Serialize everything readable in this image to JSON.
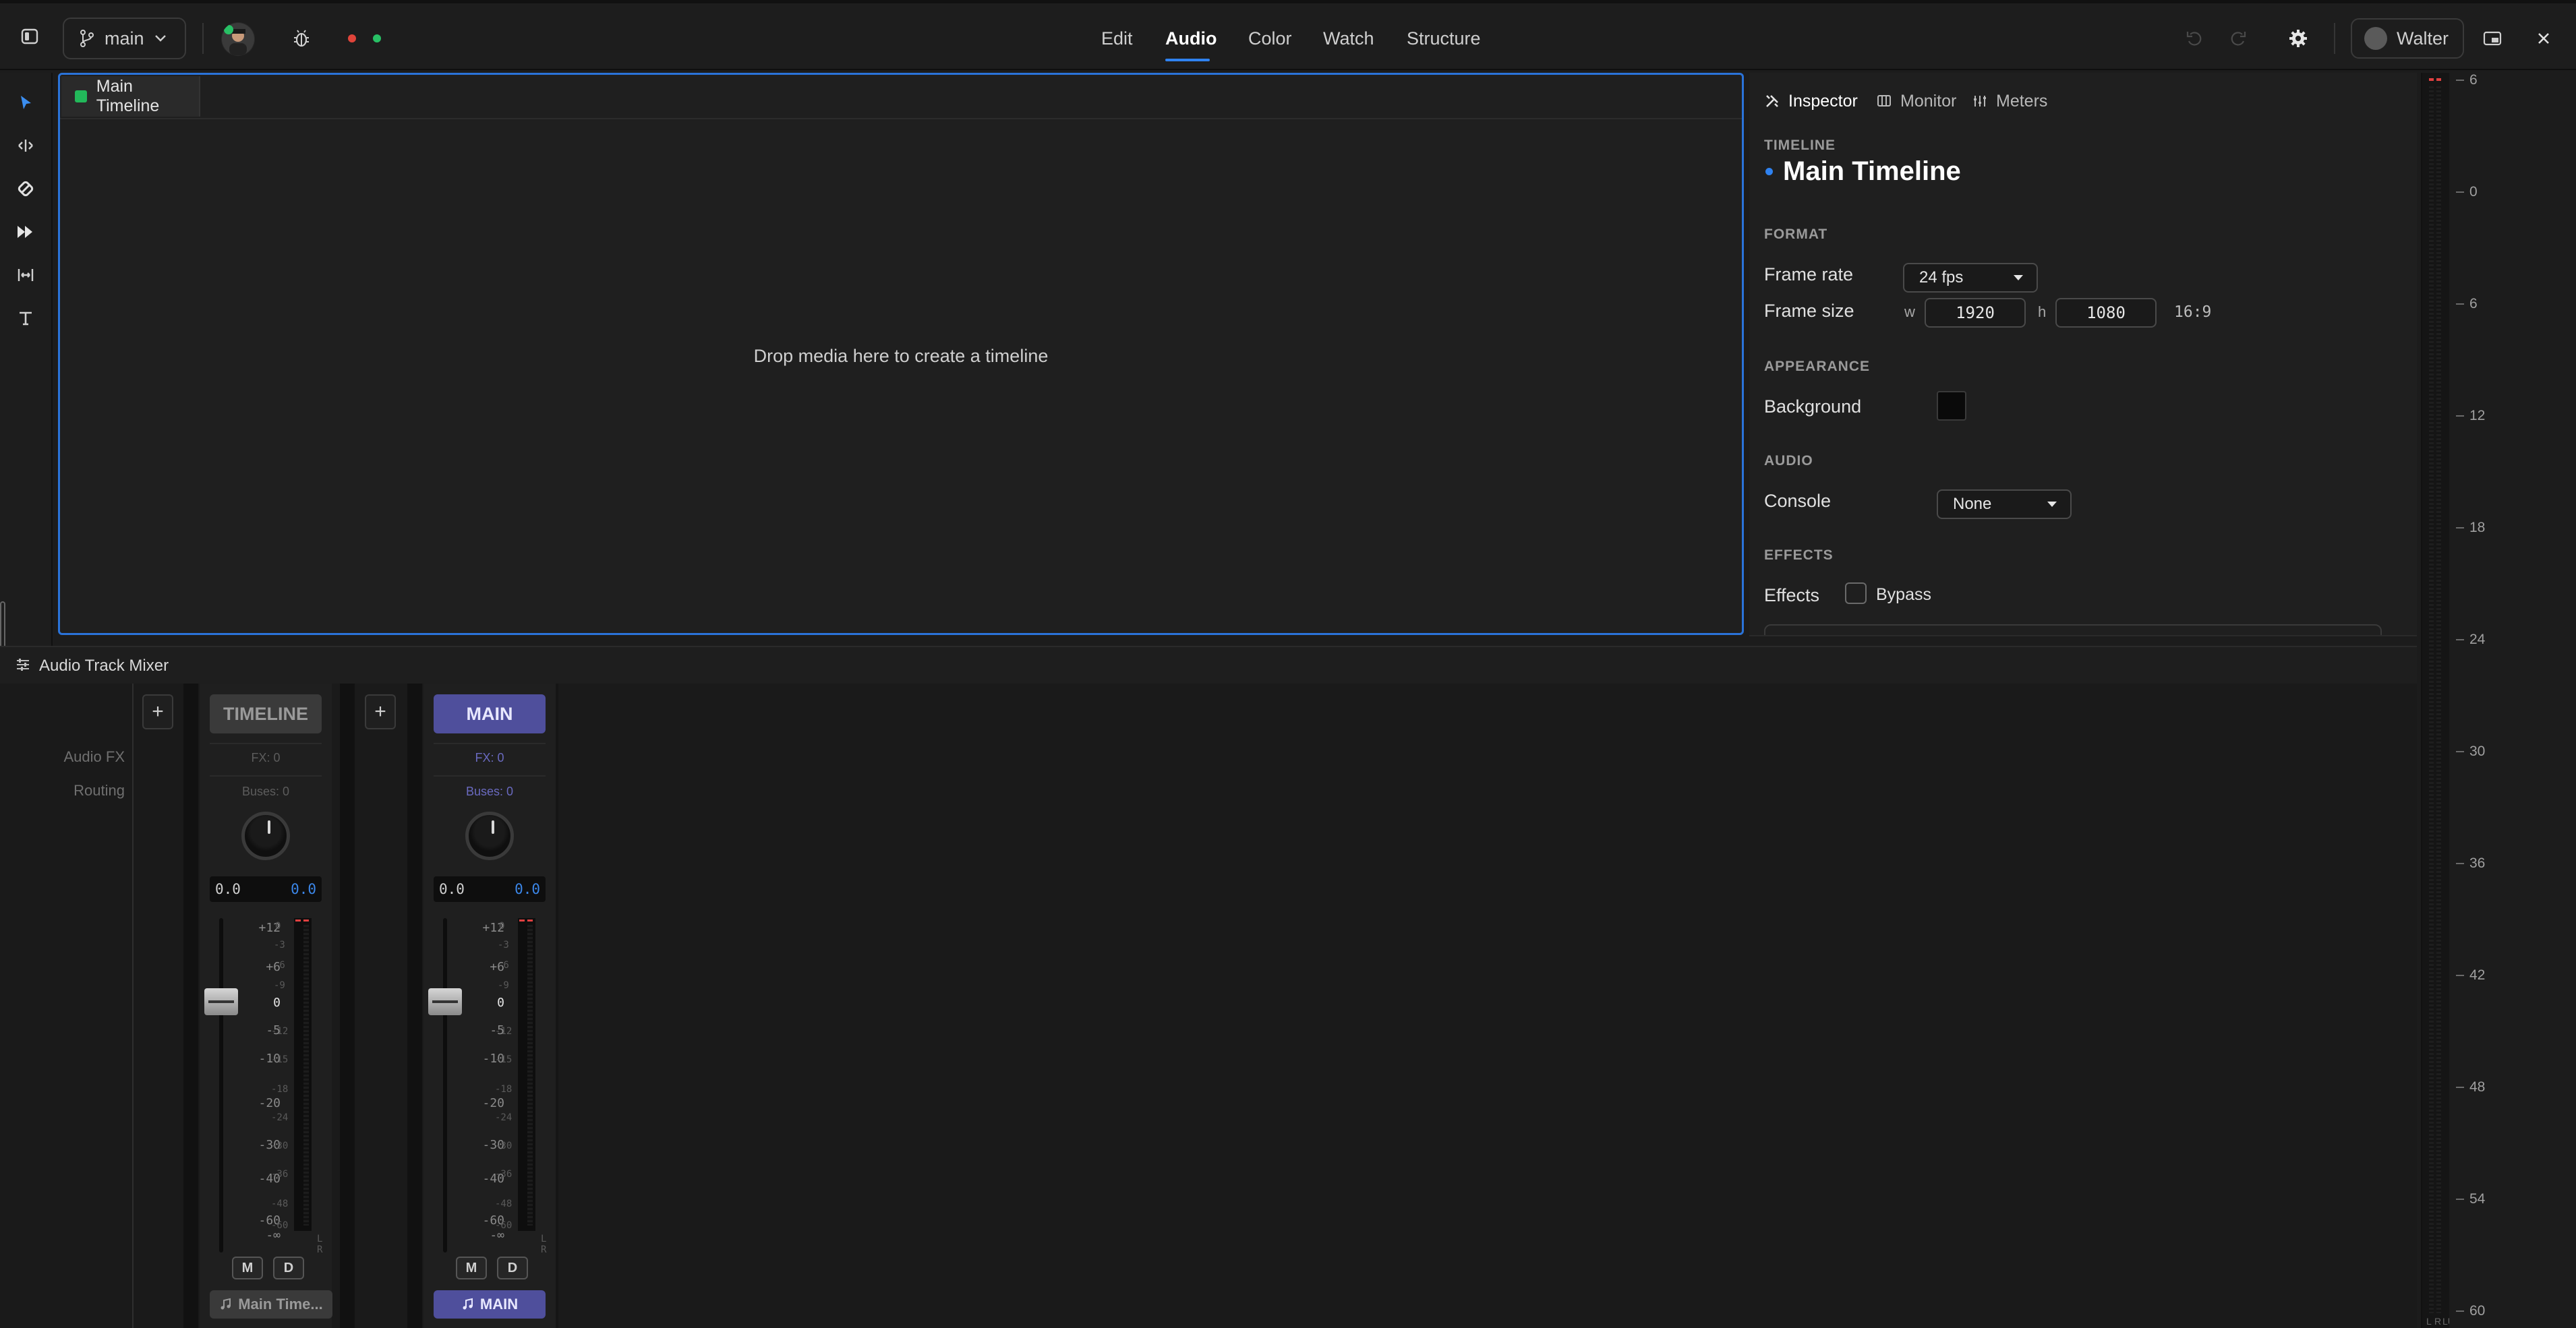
{
  "topbar": {
    "branch": "main",
    "nav": [
      "Edit",
      "Audio",
      "Color",
      "Watch",
      "Structure"
    ],
    "active_nav": "Audio",
    "user": "Walter",
    "status_dot_colors": [
      "#e0443a",
      "#28c065"
    ],
    "icons": [
      "sidebar-toggle-icon",
      "git-branch-icon",
      "chevron-down-icon",
      "bug-icon",
      "undo-icon",
      "redo-icon",
      "gear-icon",
      "picture-in-picture-icon",
      "close-icon"
    ]
  },
  "tools": [
    "pointer-icon",
    "trim-icon",
    "razor-icon",
    "forward-icon",
    "slip-icon",
    "text-icon"
  ],
  "timeline": {
    "tab_label": "Main Timeline",
    "tab_color": "#22b85a",
    "drop_text": "Drop media here to create a timeline"
  },
  "inspector": {
    "tabs": [
      "Inspector",
      "Monitor",
      "Meters"
    ],
    "active_tab": "Inspector",
    "timeline_section": "TIMELINE",
    "timeline_name": "Main Timeline",
    "format_section": "FORMAT",
    "frame_rate_label": "Frame rate",
    "frame_rate_value": "24 fps",
    "frame_size_label": "Frame size",
    "w_label": "w",
    "width_value": "1920",
    "h_label": "h",
    "height_value": "1080",
    "aspect_ratio": "16:9",
    "appearance_section": "APPEARANCE",
    "background_label": "Background",
    "background_color": "#0a0a0a",
    "audio_section": "AUDIO",
    "console_label": "Console",
    "console_value": "None",
    "effects_section": "EFFECTS",
    "effects_label": "Effects",
    "bypass_label": "Bypass",
    "bypass_checked": false
  },
  "meter_scale": [
    "6",
    "0",
    "6",
    "12",
    "18",
    "24",
    "30",
    "36",
    "42",
    "48",
    "54",
    "60"
  ],
  "meter_footer": [
    "L",
    "R",
    "LU"
  ],
  "mixer": {
    "title": "Audio Track Mixer",
    "row_labels": [
      "Audio FX",
      "Routing"
    ],
    "add_label": "+",
    "strips": [
      {
        "name": "TIMELINE",
        "fx": "FX: 0",
        "buses": "Buses: 0",
        "pan": "0.0",
        "gain": "0.0",
        "mute": "M",
        "dim": "D",
        "output": "Main Time...",
        "style": "timeline"
      },
      {
        "name": "MAIN",
        "fx": "FX: 0",
        "buses": "Buses: 0",
        "pan": "0.0",
        "gain": "0.0",
        "mute": "M",
        "dim": "D",
        "output": "MAIN",
        "style": "main"
      }
    ],
    "fader_scale": [
      "+12",
      "+6",
      "0",
      "-5",
      "-10",
      "-20",
      "-30",
      "-40",
      "-60",
      "-∞"
    ],
    "mini_meter_scale": [
      "0",
      "-3",
      "-6",
      "-9",
      "-12",
      "-15",
      "-18",
      "-24",
      "-30",
      "-36",
      "-48",
      "-60"
    ],
    "mini_meter_footer": "L R",
    "colors": {
      "main_strip": "#4f4f9c",
      "main_text": "#e8e8ff",
      "timeline_strip": "#3a3a3a",
      "gain_blue": "#3b86e8",
      "clip_red": "#e04040"
    }
  }
}
